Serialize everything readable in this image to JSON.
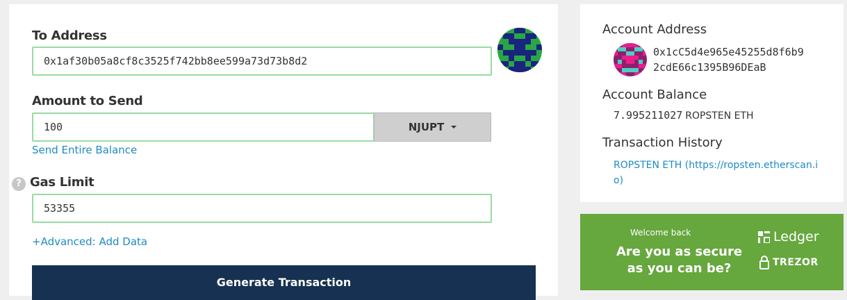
{
  "form": {
    "to_address_label": "To Address",
    "to_address_value": "0x1af30b05a8cf8c3525f742bb8ee599a73d73b8d2",
    "amount_label": "Amount to Send",
    "amount_value": "100",
    "token_selected": "NJUPT",
    "send_entire_balance": "Send Entire Balance",
    "gas_limit_help": "?",
    "gas_limit_label": "Gas Limit",
    "gas_limit_value": "53355",
    "advanced_link": "+Advanced: Add Data",
    "generate_button": "Generate Transaction"
  },
  "sidebar": {
    "account_address_label": "Account Address",
    "address_line1": "0x1cC5d4e965e45255d8f6b9",
    "address_line2": "2cdE66c1395B96DEaB",
    "account_balance_label": "Account Balance",
    "balance_value": "7.995211027",
    "balance_unit": "ROPSTEN ETH",
    "tx_history_label": "Transaction History",
    "tx_history_line1": "ROPSTEN ETH (https://ropsten.etherscan.i",
    "tx_history_line2": "o)"
  },
  "banner": {
    "welcome": "Welcome back",
    "headline1": "Are you as secure",
    "headline2": "as you can be?",
    "ledger": "Ledger",
    "trezor": "TREZOR"
  },
  "colors": {
    "input_border": "#98dba2",
    "link": "#1f8ac4",
    "button_bg": "#163151",
    "banner_bg": "#66a73e"
  }
}
